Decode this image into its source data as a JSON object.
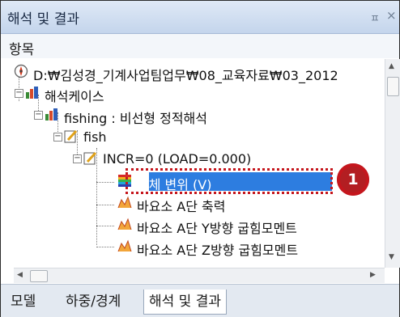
{
  "panel": {
    "title": "해석 및 결과",
    "pin_glyph": "ㅍ",
    "close_glyph": "×",
    "section_header": "항목"
  },
  "tree": {
    "root": "D:₩김성경_기계사업팀업무₩08_교육자료₩03_2012",
    "analysis_cases": "해석케이스",
    "case": "fishing : 비선형 정적해석",
    "model": "fish",
    "increment": "INCR=0 (LOAD=0.000)",
    "items": [
      "전체 변위 (V)",
      "바요소 A단 축력",
      "바요소 A단 Y방향 굽힘모멘트",
      "바요소 A단 Z방향 굽힘모멘트"
    ],
    "selected_index": 0
  },
  "annotation": {
    "badge_number": "1"
  },
  "tabs": [
    {
      "label": "모델",
      "active": false
    },
    {
      "label": "하중/경계",
      "active": false
    },
    {
      "label": "해석 및 결과",
      "active": true
    }
  ],
  "colors": {
    "title_bg": "#c4d5ec",
    "selection": "#2d7de0",
    "highlight": "#c5161d"
  }
}
